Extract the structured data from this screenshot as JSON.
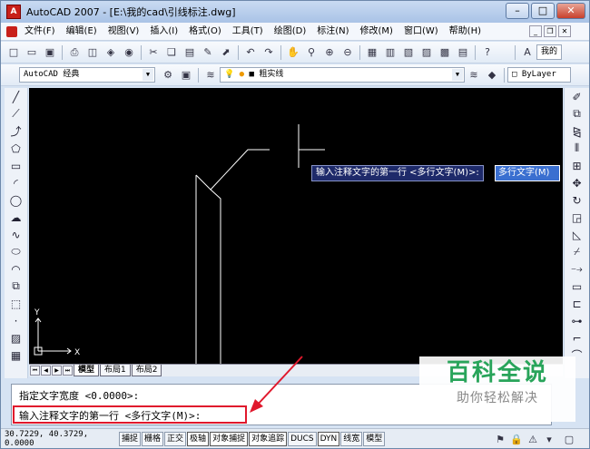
{
  "window": {
    "title": "AutoCAD 2007 - [E:\\我的cad\\引线标注.dwg]",
    "icon_label": "A",
    "controls": {
      "minimize": "–",
      "maximize": "□",
      "close": "✕"
    }
  },
  "menubar": {
    "items": [
      "文件(F)",
      "编辑(E)",
      "视图(V)",
      "插入(I)",
      "格式(O)",
      "工具(T)",
      "绘图(D)",
      "标注(N)",
      "修改(M)",
      "窗口(W)",
      "帮助(H)"
    ],
    "doc_controls": {
      "minimize": "_",
      "restore": "❐",
      "close": "✕"
    },
    "right_label": "我的"
  },
  "toolbar2": {
    "workspace": "AutoCAD 经典",
    "layer": "粗实线",
    "linetype": "ByLayer"
  },
  "tooltip": {
    "prompt": "输入注释文字的第一行 <多行文字(M)>:",
    "input_value": "多行文字(M)"
  },
  "ucs": {
    "x_label": "X",
    "y_label": "Y"
  },
  "tabs": {
    "items": [
      "模型",
      "布局1",
      "布局2"
    ]
  },
  "command": {
    "line1": "指定文字宽度 <0.0000>:",
    "line2": "输入注释文字的第一行 <多行文字(M)>:"
  },
  "status": {
    "coords": "30.7229, 40.3729, 0.0000",
    "buttons": [
      "捕捉",
      "栅格",
      "正交",
      "极轴",
      "对象捕捉",
      "对象追踪",
      "DUCS",
      "DYN",
      "线宽",
      "模型"
    ]
  },
  "watermark": {
    "title": "百科全说",
    "subtitle": "助你轻松解决"
  },
  "colors": {
    "highlight": "#e0182c",
    "watermark_green": "#28a45a"
  }
}
